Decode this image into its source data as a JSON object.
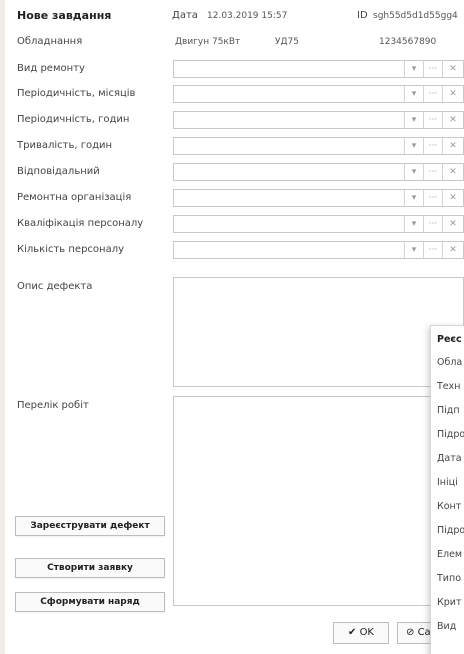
{
  "header": {
    "title": "Нове завдання",
    "date_label": "Дата",
    "date_value": "12.03.2019 15:57",
    "id_label": "ID",
    "id_value": "sgh55d5d1d55gg4"
  },
  "equipment": {
    "label": "Обладнання",
    "name": "Двигун 75кВт",
    "code": "УД75",
    "serial": "1234567890"
  },
  "fields": [
    {
      "label": "Вид ремонту"
    },
    {
      "label": "Періодичність, місяців"
    },
    {
      "label": "Періодичність, годин"
    },
    {
      "label": "Тривалість, годин"
    },
    {
      "label": "Відповідальний"
    },
    {
      "label": "Ремонтна організація"
    },
    {
      "label": "Кваліфікація персоналу"
    },
    {
      "label": "Кількість персоналу"
    }
  ],
  "combo_icons": {
    "chevron": "▾",
    "more": "···",
    "clear": "✕"
  },
  "defect_description_label": "Опис дефекта",
  "work_list_label": "Перелік робіт",
  "buttons": {
    "register_defect": "Зареєструвати дефект",
    "create_request": "Створити заявку",
    "form_order": "Сформувати наряд",
    "ok": "OK",
    "ok_icon": "✔",
    "cancel_icon": "⊘",
    "cancel": "Ca"
  },
  "popup": {
    "title": "Реєс",
    "items": [
      "Обла",
      "Техн",
      "Підп",
      "Підро",
      "Дата",
      "Ініці",
      "Конт",
      "Підро",
      "Елем",
      "Типо",
      "Крит",
      "Вид"
    ]
  }
}
